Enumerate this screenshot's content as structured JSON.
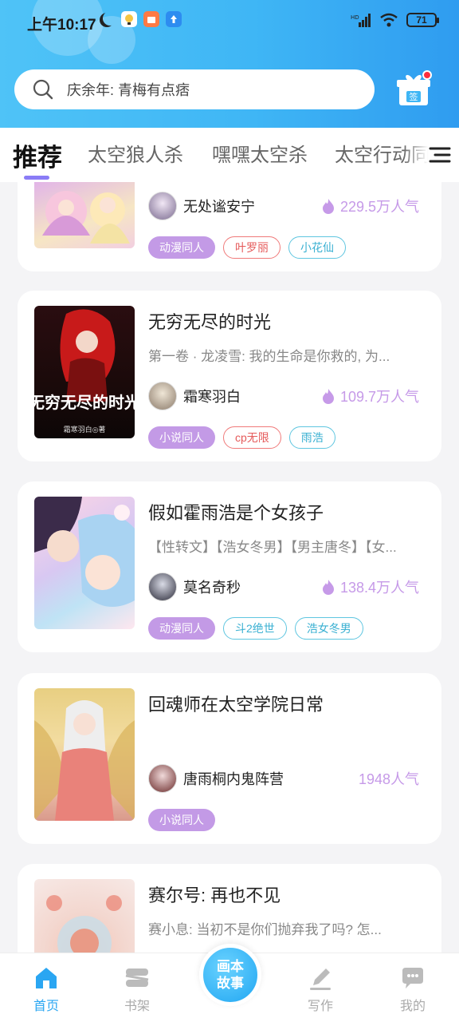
{
  "status_bar": {
    "time": "上午10:17",
    "battery": "71"
  },
  "search": {
    "placeholder": "庆余年: 青梅有点痞"
  },
  "gift": {
    "label": "签"
  },
  "tabs": [
    {
      "label": "推荐",
      "active": true
    },
    {
      "label": "太空狼人杀"
    },
    {
      "label": "嘿嘿太空杀"
    },
    {
      "label": "太空行动同"
    }
  ],
  "cards": [
    {
      "title": "",
      "desc": "",
      "author": "无处谧安宁",
      "popularity": "229.5万人气",
      "tags": [
        {
          "label": "动漫同人",
          "style": "purple"
        },
        {
          "label": "叶罗丽",
          "style": "red"
        },
        {
          "label": "小花仙",
          "style": "teal"
        }
      ]
    },
    {
      "title": "无穷无尽的时光",
      "desc": "第一卷 · 龙凌雪: 我的生命是你救的, 为...",
      "author": "霜寒羽白",
      "popularity": "109.7万人气",
      "cover_text": "无穷无尽的时光",
      "cover_sub": "霜寒羽白◎著",
      "tags": [
        {
          "label": "小说同人",
          "style": "purple"
        },
        {
          "label": "cp无限",
          "style": "red"
        },
        {
          "label": "雨浩",
          "style": "teal"
        }
      ]
    },
    {
      "title": "假如霍雨浩是个女孩子",
      "desc": "【性转文】【浩女冬男】【男主唐冬】【女...",
      "author": "莫名奇秒",
      "popularity": "138.4万人气",
      "tags": [
        {
          "label": "动漫同人",
          "style": "purple"
        },
        {
          "label": "斗2绝世",
          "style": "teal"
        },
        {
          "label": "浩女冬男",
          "style": "teal"
        }
      ]
    },
    {
      "title": "回魂师在太空学院日常",
      "desc": "",
      "author": "唐雨桐内鬼阵营",
      "popularity": "1948人气",
      "tags": [
        {
          "label": "小说同人",
          "style": "purple"
        }
      ]
    },
    {
      "title": "赛尔号: 再也不见",
      "desc": "赛小息: 当初不是你们抛弃我了吗? 怎...",
      "author": "",
      "popularity": "",
      "tags": []
    }
  ],
  "bottom_nav": {
    "home": "首页",
    "shelf": "书架",
    "center_line1": "画本",
    "center_line2": "故事",
    "write": "写作",
    "mine": "我的"
  },
  "colors": {
    "accent": "#2aa6f2",
    "popularity": "#c69ae8",
    "tab_indicator": "#8a7cf6"
  }
}
